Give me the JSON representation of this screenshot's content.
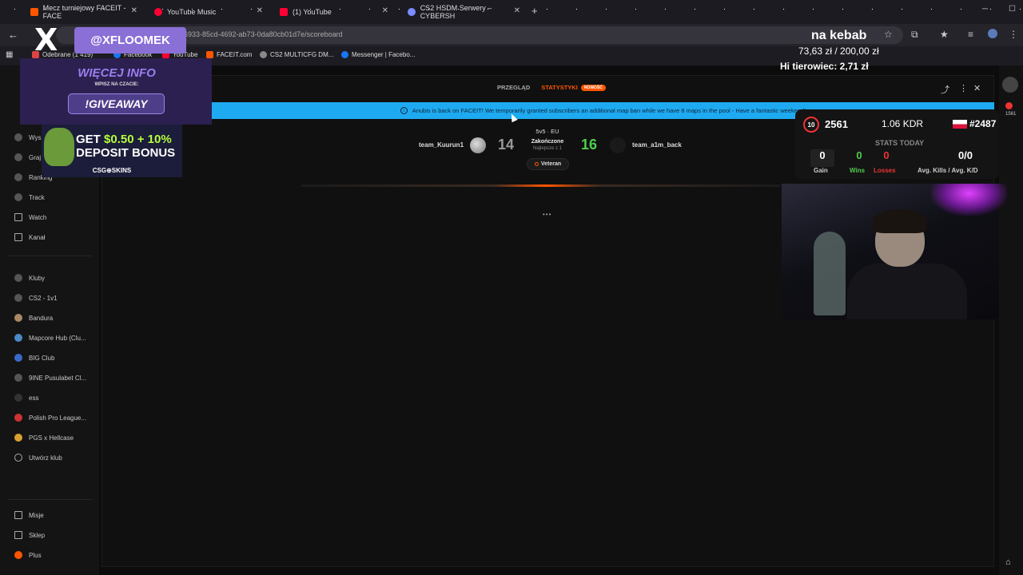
{
  "tabs": [
    {
      "title": "Mecz turniejowy FACEIT - FACE",
      "color": "#ff5500"
    },
    {
      "title": "YouTube Music",
      "color": "#ff0033"
    },
    {
      "title": "(1) YouTube",
      "color": "#ff0033"
    },
    {
      "title": "CS2 HSDM Serwery – CYBERSH",
      "color": "#7a8cff"
    }
  ],
  "address": {
    "url": "6933-85cd-4692-ab73-0da80cb01d7e/scoreboard"
  },
  "bookmarks": [
    "Odebrane (1 419)",
    "Facebook",
    "YouTube",
    "FACEIT.com",
    "CS2 MULTICFG DM...",
    "Messenger | Facebo..."
  ],
  "sidebar": {
    "items": [
      "Wyszukaj",
      "Graj",
      "Ranking",
      "Track",
      "Watch",
      "Kanał"
    ],
    "clubs": [
      "Kluby",
      "CS2 - 1v1",
      "Bandura",
      "Mapcore Hub (Clu...",
      "BIG Club",
      "9INE Pusulabet Cl...",
      "ess",
      "Polish Pro League...",
      "PGS x Hellcase",
      "Utwórz klub"
    ],
    "bottom": [
      "Misje",
      "Sklep",
      "Plus"
    ]
  },
  "modal": {
    "tab_overview": "PRZEGLĄD",
    "tab_stats": "STATYSTYKI",
    "new_badge": "NOWOŚĆ",
    "banner": "Anubis is back on FACEIT! We temporarily granted subscribers an additional map ban while we have 8 maps in the pool - Have a fantastic weekend!"
  },
  "match": {
    "team1": "team_Kuurun1",
    "team2": "team_a1m_back",
    "score1": "14",
    "score2": "16",
    "mode": "5v5 · EU",
    "status": "Zakończone",
    "best_of": "Najlepsze z 1",
    "skill": "Veteran",
    "loading": "•••"
  },
  "overlay": {
    "x_handle": "@XFLOOMEK",
    "info_title": "WIĘCEJ INFO",
    "info_sub": "WPISZ NA CZACIE:",
    "giveaway": "!GIVEAWAY",
    "promo_get": "GET ",
    "promo_amount": "$0.50 + 10%",
    "promo_bonus": "DEPOSIT BONUS",
    "promo_brand": "CSG⊕SKINS",
    "donation_title": "na kebab",
    "donation_amount": "73,63 zł / 200,00 zł",
    "top_donor": "Hi tierowiec: 2,71 zł"
  },
  "faceit_widget": {
    "level": "10",
    "elo": "2561",
    "kdr": "1.06 KDR",
    "rank": "#2487",
    "stats_today": "STATS TODAY",
    "gain_value": "0",
    "gain_label": "Gain",
    "wins_value": "0",
    "wins_label": "Wins",
    "losses_value": "0",
    "losses_label": "Losses",
    "avg_value": "0/0",
    "avg_label": "Avg. Kills / Avg. K/D"
  },
  "right_panel": {
    "elo_badge": "1561"
  }
}
